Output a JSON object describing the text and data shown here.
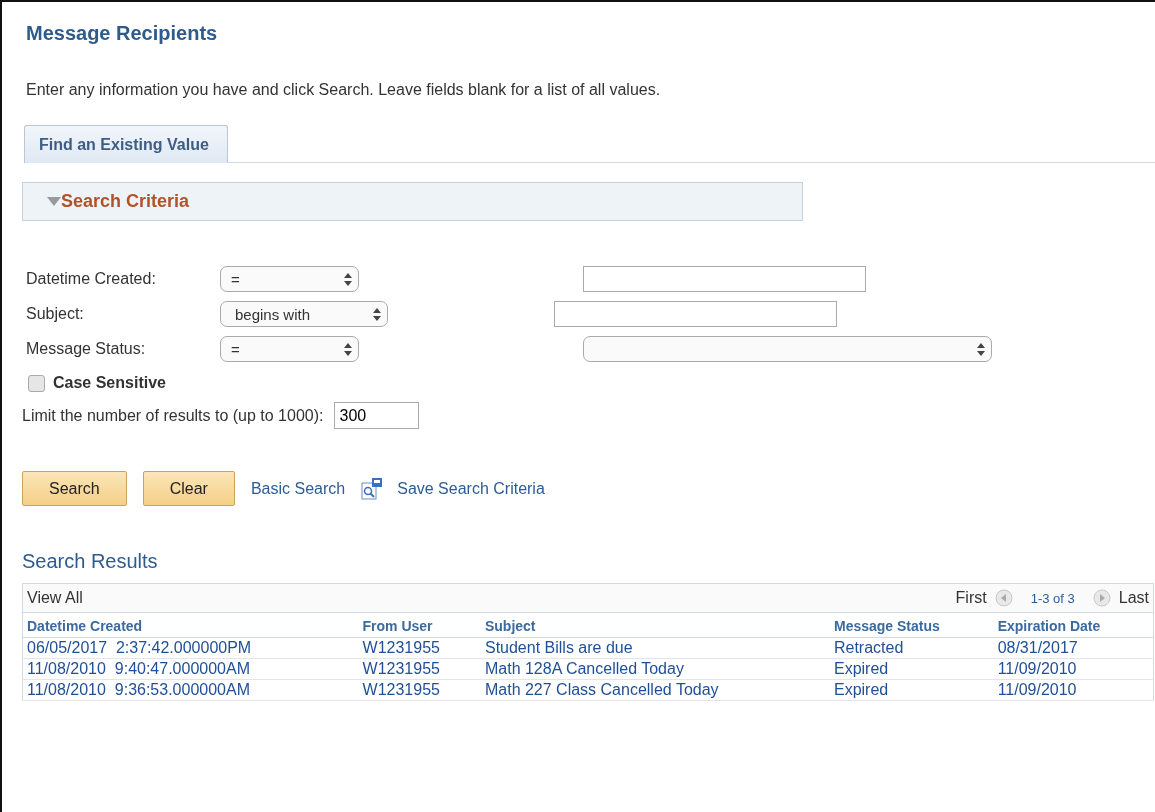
{
  "page": {
    "title": "Message Recipients",
    "instructions": "Enter any information you have and click Search. Leave fields blank for a list of all values."
  },
  "tabs": [
    {
      "label": "Find an Existing Value",
      "selected": true
    }
  ],
  "criteria": {
    "title": "Search Criteria",
    "expanded": true,
    "fields": [
      {
        "label": "Datetime Created:",
        "operator": "=",
        "kind": "text"
      },
      {
        "label": "Subject:",
        "operator": "begins with",
        "kind": "text"
      },
      {
        "label": "Message Status:",
        "operator": "=",
        "kind": "select"
      }
    ],
    "case_sensitive": {
      "label": "Case Sensitive",
      "checked": false
    },
    "limit": {
      "label": "Limit the number of results to (up to 1000):",
      "value": "300"
    }
  },
  "buttons": [
    "Search",
    "Clear"
  ],
  "links": [
    {
      "label": "Basic Search",
      "kind": "plain"
    },
    {
      "label": "Save Search Criteria",
      "kind": "save"
    }
  ],
  "results": {
    "title": "Search Results",
    "view_all": "View All",
    "first": "First",
    "range": "1-3 of 3",
    "last": "Last",
    "columns": [
      "Datetime Created",
      "From User",
      "Subject",
      "Message Status",
      "Expiration Date"
    ],
    "rows": [
      [
        "06/05/2017  2:37:42.000000PM",
        "W1231955",
        "Student Bills are due",
        "Retracted",
        "08/31/2017"
      ],
      [
        "11/08/2010  9:40:47.000000AM",
        "W1231955",
        "Math 128A Cancelled Today",
        "Expired",
        "11/09/2010"
      ],
      [
        "11/08/2010  9:36:53.000000AM",
        "W1231955",
        "Math 227 Class Cancelled Today",
        "Expired",
        "11/09/2010"
      ]
    ]
  }
}
